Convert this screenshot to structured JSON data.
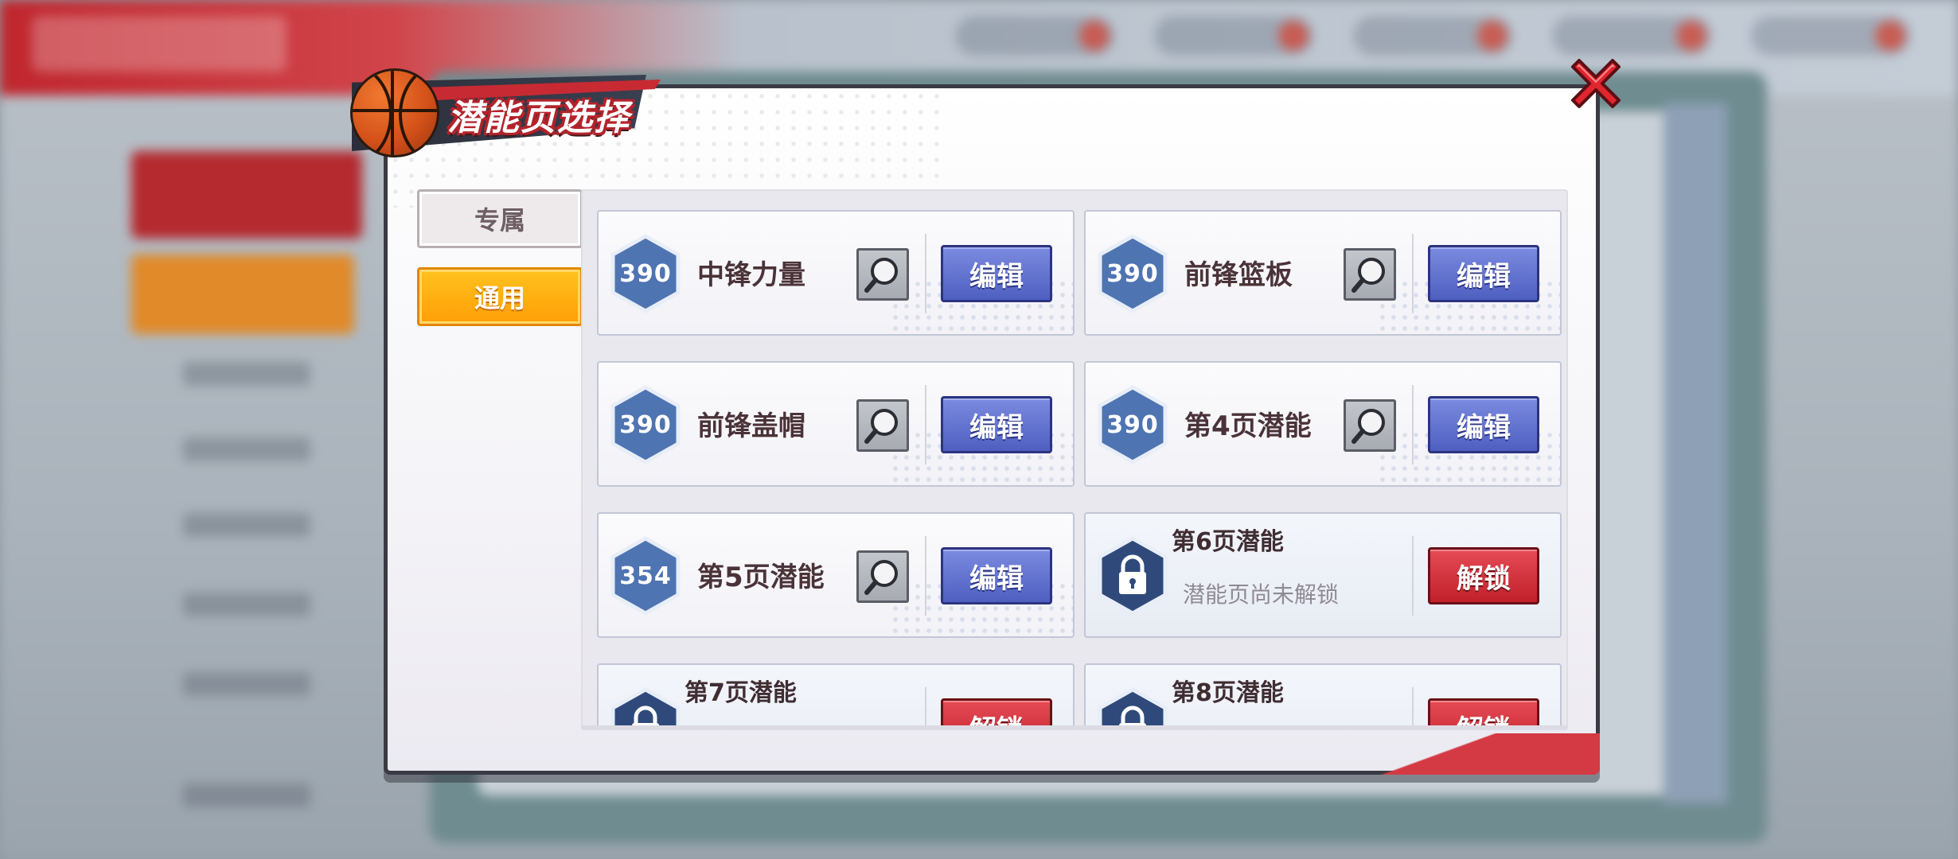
{
  "dialog": {
    "title": "潜能页选择",
    "close_icon": "close-x-icon",
    "tabs": [
      {
        "label": "专属",
        "selected": false
      },
      {
        "label": "通用",
        "selected": true
      }
    ]
  },
  "pages": [
    {
      "name": "中锋力量",
      "score": "390",
      "locked": false,
      "action": "编辑"
    },
    {
      "name": "前锋篮板",
      "score": "390",
      "locked": false,
      "action": "编辑"
    },
    {
      "name": "前锋盖帽",
      "score": "390",
      "locked": false,
      "action": "编辑"
    },
    {
      "name": "第4页潜能",
      "score": "390",
      "locked": false,
      "action": "编辑"
    },
    {
      "name": "第5页潜能",
      "score": "354",
      "locked": false,
      "action": "编辑"
    },
    {
      "name": "第6页潜能",
      "locked": true,
      "status": "潜能页尚未解锁",
      "action": "解锁"
    },
    {
      "name": "第7页潜能",
      "locked": true,
      "action": "解锁"
    },
    {
      "name": "第8页潜能",
      "locked": true,
      "action": "解锁"
    }
  ],
  "colors": {
    "accent_orange": "#ff9e06",
    "edit_blue": "#4e5fc0",
    "unlock_red": "#c0202a",
    "score_hex_blue": "#4f74b2"
  }
}
